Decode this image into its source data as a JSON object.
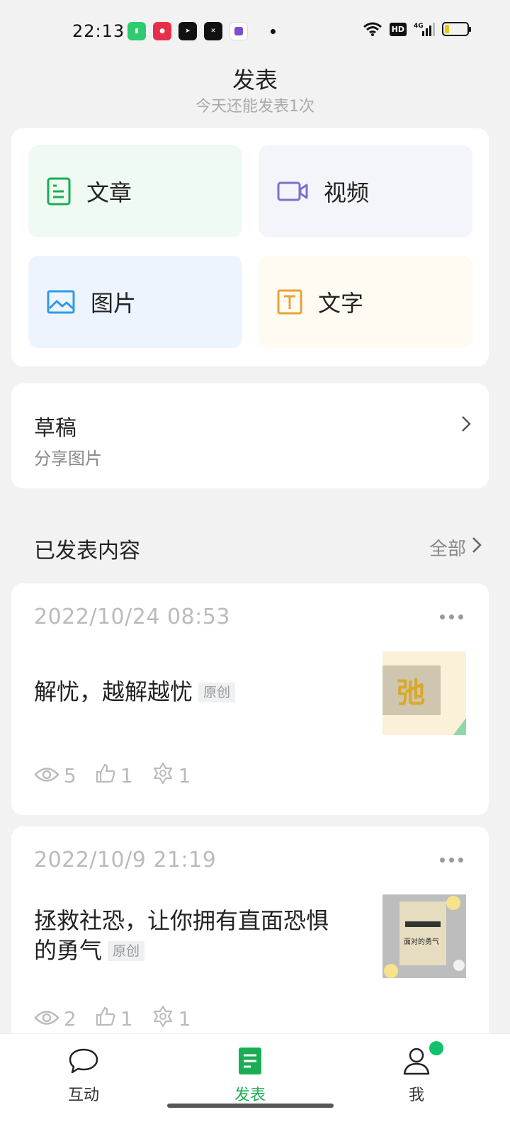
{
  "status_bar": {
    "time": "22:13",
    "hd": "HD",
    "network": "4G"
  },
  "header": {
    "title": "发表",
    "subtitle": "今天还能发表1次"
  },
  "publish_options": [
    {
      "label": "文章",
      "icon": "article-icon",
      "color": "#1aad54"
    },
    {
      "label": "视频",
      "icon": "video-icon",
      "color": "#7b6fd0"
    },
    {
      "label": "图片",
      "icon": "image-icon",
      "color": "#2e9be6"
    },
    {
      "label": "文字",
      "icon": "text-icon",
      "color": "#e8a33a"
    }
  ],
  "drafts": {
    "title": "草稿",
    "subtitle": "分享图片"
  },
  "published": {
    "title": "已发表内容",
    "all_label": "全部"
  },
  "posts": [
    {
      "timestamp": "2022/10/24 08:53",
      "title": "解忧，越解越忧",
      "badge": "原创",
      "views": "5",
      "likes": "1",
      "shares": "1",
      "thumb_text": "弛"
    },
    {
      "timestamp": "2022/10/9 21:19",
      "title": "拯救社恐，让你拥有直面恐惧的勇气",
      "badge": "原创",
      "views": "2",
      "likes": "1",
      "shares": "1",
      "thumb_text": "面对的勇气"
    }
  ],
  "bottom_nav": [
    {
      "label": "互动",
      "icon": "chat-bubble-icon"
    },
    {
      "label": "发表",
      "icon": "publish-doc-icon",
      "active": true
    },
    {
      "label": "我",
      "icon": "person-icon"
    }
  ],
  "colors": {
    "accent": "#1aad54",
    "background": "#f2f2f2"
  }
}
